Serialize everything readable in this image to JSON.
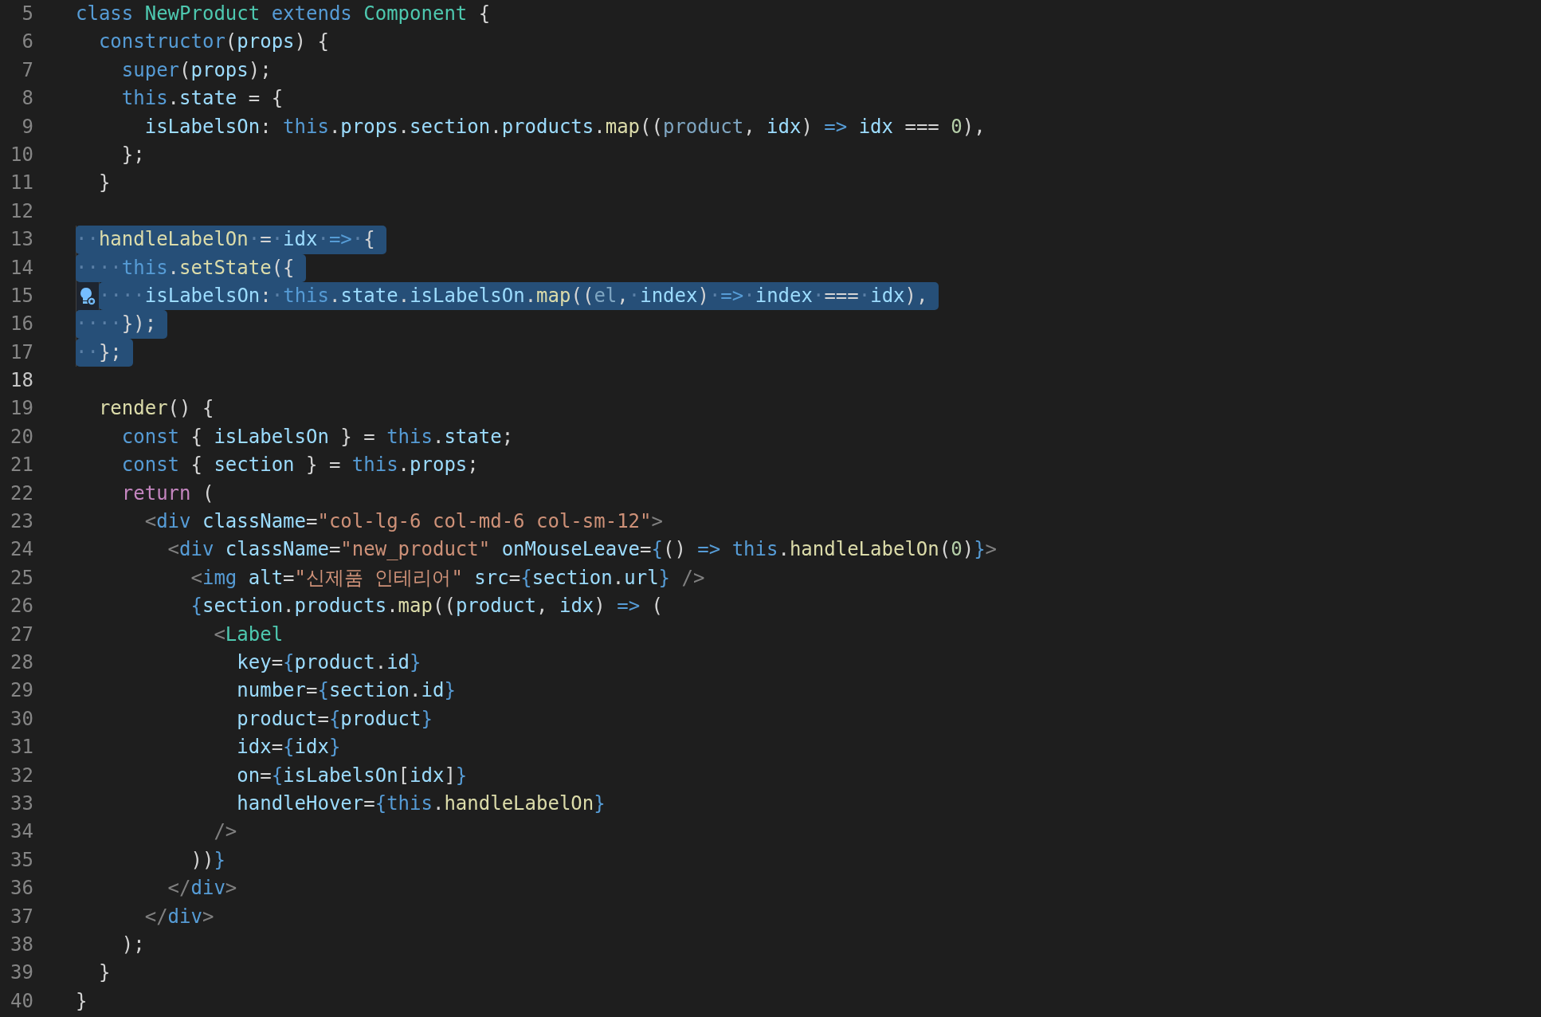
{
  "lines": [
    {
      "number": "5",
      "selected": false,
      "active": false,
      "lightbulb": false,
      "tokens": [
        {
          "kind": "kw",
          "text": "class "
        },
        {
          "kind": "type",
          "text": "NewProduct"
        },
        {
          "kind": "kw",
          "text": " extends "
        },
        {
          "kind": "type",
          "text": "Component"
        },
        {
          "kind": "pun",
          "text": " {"
        }
      ]
    },
    {
      "number": "6",
      "selected": false,
      "active": false,
      "lightbulb": false,
      "tokens": [
        {
          "kind": "kw",
          "text": "  constructor"
        },
        {
          "kind": "pun",
          "text": "("
        },
        {
          "kind": "var",
          "text": "props"
        },
        {
          "kind": "pun",
          "text": ") {"
        }
      ]
    },
    {
      "number": "7",
      "selected": false,
      "active": false,
      "lightbulb": false,
      "tokens": [
        {
          "kind": "kw",
          "text": "    super"
        },
        {
          "kind": "pun",
          "text": "("
        },
        {
          "kind": "var",
          "text": "props"
        },
        {
          "kind": "pun",
          "text": ");"
        }
      ]
    },
    {
      "number": "8",
      "selected": false,
      "active": false,
      "lightbulb": false,
      "tokens": [
        {
          "kind": "kw",
          "text": "    this"
        },
        {
          "kind": "pun",
          "text": "."
        },
        {
          "kind": "var",
          "text": "state"
        },
        {
          "kind": "pun",
          "text": " = {"
        }
      ]
    },
    {
      "number": "9",
      "selected": false,
      "active": false,
      "lightbulb": false,
      "tokens": [
        {
          "kind": "var",
          "text": "      isLabelsOn"
        },
        {
          "kind": "pun",
          "text": ": "
        },
        {
          "kind": "kw",
          "text": "this"
        },
        {
          "kind": "pun",
          "text": "."
        },
        {
          "kind": "var",
          "text": "props"
        },
        {
          "kind": "pun",
          "text": "."
        },
        {
          "kind": "var",
          "text": "section"
        },
        {
          "kind": "pun",
          "text": "."
        },
        {
          "kind": "var",
          "text": "products"
        },
        {
          "kind": "pun",
          "text": "."
        },
        {
          "kind": "fn",
          "text": "map"
        },
        {
          "kind": "pun",
          "text": "(("
        },
        {
          "kind": "unused",
          "text": "product"
        },
        {
          "kind": "pun",
          "text": ", "
        },
        {
          "kind": "var",
          "text": "idx"
        },
        {
          "kind": "pun",
          "text": ") "
        },
        {
          "kind": "kw",
          "text": "=>"
        },
        {
          "kind": "var",
          "text": " idx"
        },
        {
          "kind": "pun",
          "text": " === "
        },
        {
          "kind": "num",
          "text": "0"
        },
        {
          "kind": "pun",
          "text": "),"
        }
      ]
    },
    {
      "number": "10",
      "selected": false,
      "active": false,
      "lightbulb": false,
      "tokens": [
        {
          "kind": "pun",
          "text": "    };"
        }
      ]
    },
    {
      "number": "11",
      "selected": false,
      "active": false,
      "lightbulb": false,
      "tokens": [
        {
          "kind": "pun",
          "text": "  }"
        }
      ]
    },
    {
      "number": "12",
      "selected": false,
      "active": false,
      "lightbulb": false
    },
    {
      "number": "13",
      "selected": true,
      "active": false,
      "lightbulb": false,
      "tokens": [
        {
          "kind": "ws",
          "text": "··"
        },
        {
          "kind": "fn",
          "text": "handleLabelOn"
        },
        {
          "kind": "ws",
          "text": "·"
        },
        {
          "kind": "pun",
          "text": "="
        },
        {
          "kind": "ws",
          "text": "·"
        },
        {
          "kind": "var",
          "text": "idx"
        },
        {
          "kind": "ws",
          "text": "·"
        },
        {
          "kind": "kw",
          "text": "=>"
        },
        {
          "kind": "ws",
          "text": "·"
        },
        {
          "kind": "pun",
          "text": "{"
        }
      ]
    },
    {
      "number": "14",
      "selected": true,
      "active": false,
      "lightbulb": false,
      "tokens": [
        {
          "kind": "ws",
          "text": "····"
        },
        {
          "kind": "kw",
          "text": "this"
        },
        {
          "kind": "pun",
          "text": "."
        },
        {
          "kind": "fn",
          "text": "setState"
        },
        {
          "kind": "pun",
          "text": "({"
        }
      ]
    },
    {
      "number": "15",
      "selected": true,
      "active": false,
      "lightbulb": true,
      "tokens": [
        {
          "kind": "ws",
          "text": "····"
        },
        {
          "kind": "var",
          "text": "isLabelsOn"
        },
        {
          "kind": "pun",
          "text": ":"
        },
        {
          "kind": "ws",
          "text": "·"
        },
        {
          "kind": "kw",
          "text": "this"
        },
        {
          "kind": "pun",
          "text": "."
        },
        {
          "kind": "var",
          "text": "state"
        },
        {
          "kind": "pun",
          "text": "."
        },
        {
          "kind": "var",
          "text": "isLabelsOn"
        },
        {
          "kind": "pun",
          "text": "."
        },
        {
          "kind": "fn",
          "text": "map"
        },
        {
          "kind": "pun",
          "text": "(("
        },
        {
          "kind": "unused",
          "text": "el"
        },
        {
          "kind": "pun",
          "text": ","
        },
        {
          "kind": "ws",
          "text": "·"
        },
        {
          "kind": "var",
          "text": "index"
        },
        {
          "kind": "pun",
          "text": ")"
        },
        {
          "kind": "ws",
          "text": "·"
        },
        {
          "kind": "kw",
          "text": "=>"
        },
        {
          "kind": "ws",
          "text": "·"
        },
        {
          "kind": "var",
          "text": "index"
        },
        {
          "kind": "ws",
          "text": "·"
        },
        {
          "kind": "pun",
          "text": "==="
        },
        {
          "kind": "ws",
          "text": "·"
        },
        {
          "kind": "var",
          "text": "idx"
        },
        {
          "kind": "pun",
          "text": "),"
        }
      ]
    },
    {
      "number": "16",
      "selected": true,
      "active": false,
      "lightbulb": false,
      "tokens": [
        {
          "kind": "ws",
          "text": "····"
        },
        {
          "kind": "pun",
          "text": "});"
        }
      ]
    },
    {
      "number": "17",
      "selected": true,
      "active": false,
      "lightbulb": false,
      "tokens": [
        {
          "kind": "ws",
          "text": "··"
        },
        {
          "kind": "pun",
          "text": "};"
        }
      ]
    },
    {
      "number": "18",
      "selected": false,
      "active": true,
      "lightbulb": false
    },
    {
      "number": "19",
      "selected": false,
      "active": false,
      "lightbulb": false,
      "tokens": [
        {
          "kind": "fn",
          "text": "  render"
        },
        {
          "kind": "pun",
          "text": "() {"
        }
      ]
    },
    {
      "number": "20",
      "selected": false,
      "active": false,
      "lightbulb": false,
      "tokens": [
        {
          "kind": "kw",
          "text": "    const"
        },
        {
          "kind": "pun",
          "text": " { "
        },
        {
          "kind": "var",
          "text": "isLabelsOn"
        },
        {
          "kind": "pun",
          "text": " } = "
        },
        {
          "kind": "kw",
          "text": "this"
        },
        {
          "kind": "pun",
          "text": "."
        },
        {
          "kind": "var",
          "text": "state"
        },
        {
          "kind": "pun",
          "text": ";"
        }
      ]
    },
    {
      "number": "21",
      "selected": false,
      "active": false,
      "lightbulb": false,
      "tokens": [
        {
          "kind": "kw",
          "text": "    const"
        },
        {
          "kind": "pun",
          "text": " { "
        },
        {
          "kind": "var",
          "text": "section"
        },
        {
          "kind": "pun",
          "text": " } = "
        },
        {
          "kind": "kw",
          "text": "this"
        },
        {
          "kind": "pun",
          "text": "."
        },
        {
          "kind": "var",
          "text": "props"
        },
        {
          "kind": "pun",
          "text": ";"
        }
      ]
    },
    {
      "number": "22",
      "selected": false,
      "active": false,
      "lightbulb": false,
      "tokens": [
        {
          "kind": "ctl",
          "text": "    return"
        },
        {
          "kind": "pun",
          "text": " ("
        }
      ]
    },
    {
      "number": "23",
      "selected": false,
      "active": false,
      "lightbulb": false,
      "tokens": [
        {
          "kind": "tag",
          "text": "      <"
        },
        {
          "kind": "kw",
          "text": "div"
        },
        {
          "kind": "var",
          "text": " className"
        },
        {
          "kind": "pun",
          "text": "="
        },
        {
          "kind": "str",
          "text": "\"col-lg-6 col-md-6 col-sm-12\""
        },
        {
          "kind": "tag",
          "text": ">"
        }
      ]
    },
    {
      "number": "24",
      "selected": false,
      "active": false,
      "lightbulb": false,
      "tokens": [
        {
          "kind": "tag",
          "text": "        <"
        },
        {
          "kind": "kw",
          "text": "div"
        },
        {
          "kind": "var",
          "text": " className"
        },
        {
          "kind": "pun",
          "text": "="
        },
        {
          "kind": "str",
          "text": "\"new_product\""
        },
        {
          "kind": "var",
          "text": " onMouseLeave"
        },
        {
          "kind": "pun",
          "text": "="
        },
        {
          "kind": "kw",
          "text": "{"
        },
        {
          "kind": "pun",
          "text": "() "
        },
        {
          "kind": "kw",
          "text": "=>"
        },
        {
          "kind": "kw",
          "text": " this"
        },
        {
          "kind": "pun",
          "text": "."
        },
        {
          "kind": "fn",
          "text": "handleLabelOn"
        },
        {
          "kind": "pun",
          "text": "("
        },
        {
          "kind": "num",
          "text": "0"
        },
        {
          "kind": "pun",
          "text": ")"
        },
        {
          "kind": "kw",
          "text": "}"
        },
        {
          "kind": "tag",
          "text": ">"
        }
      ]
    },
    {
      "number": "25",
      "selected": false,
      "active": false,
      "lightbulb": false,
      "tokens": [
        {
          "kind": "tag",
          "text": "          <"
        },
        {
          "kind": "kw",
          "text": "img"
        },
        {
          "kind": "var",
          "text": " alt"
        },
        {
          "kind": "pun",
          "text": "="
        },
        {
          "kind": "str",
          "text": "\"신제품 인테리어\""
        },
        {
          "kind": "var",
          "text": " src"
        },
        {
          "kind": "pun",
          "text": "="
        },
        {
          "kind": "kw",
          "text": "{"
        },
        {
          "kind": "var",
          "text": "section"
        },
        {
          "kind": "pun",
          "text": "."
        },
        {
          "kind": "var",
          "text": "url"
        },
        {
          "kind": "kw",
          "text": "}"
        },
        {
          "kind": "tag",
          "text": " />"
        }
      ]
    },
    {
      "number": "26",
      "selected": false,
      "active": false,
      "lightbulb": false,
      "tokens": [
        {
          "kind": "kw",
          "text": "          {"
        },
        {
          "kind": "var",
          "text": "section"
        },
        {
          "kind": "pun",
          "text": "."
        },
        {
          "kind": "var",
          "text": "products"
        },
        {
          "kind": "pun",
          "text": "."
        },
        {
          "kind": "fn",
          "text": "map"
        },
        {
          "kind": "pun",
          "text": "(("
        },
        {
          "kind": "var",
          "text": "product"
        },
        {
          "kind": "pun",
          "text": ", "
        },
        {
          "kind": "var",
          "text": "idx"
        },
        {
          "kind": "pun",
          "text": ") "
        },
        {
          "kind": "kw",
          "text": "=>"
        },
        {
          "kind": "pun",
          "text": " ("
        }
      ]
    },
    {
      "number": "27",
      "selected": false,
      "active": false,
      "lightbulb": false,
      "tokens": [
        {
          "kind": "tag",
          "text": "            <"
        },
        {
          "kind": "type",
          "text": "Label"
        }
      ]
    },
    {
      "number": "28",
      "selected": false,
      "active": false,
      "lightbulb": false,
      "tokens": [
        {
          "kind": "var",
          "text": "              key"
        },
        {
          "kind": "pun",
          "text": "="
        },
        {
          "kind": "kw",
          "text": "{"
        },
        {
          "kind": "var",
          "text": "product"
        },
        {
          "kind": "pun",
          "text": "."
        },
        {
          "kind": "var",
          "text": "id"
        },
        {
          "kind": "kw",
          "text": "}"
        }
      ]
    },
    {
      "number": "29",
      "selected": false,
      "active": false,
      "lightbulb": false,
      "tokens": [
        {
          "kind": "var",
          "text": "              number"
        },
        {
          "kind": "pun",
          "text": "="
        },
        {
          "kind": "kw",
          "text": "{"
        },
        {
          "kind": "var",
          "text": "section"
        },
        {
          "kind": "pun",
          "text": "."
        },
        {
          "kind": "var",
          "text": "id"
        },
        {
          "kind": "kw",
          "text": "}"
        }
      ]
    },
    {
      "number": "30",
      "selected": false,
      "active": false,
      "lightbulb": false,
      "tokens": [
        {
          "kind": "var",
          "text": "              product"
        },
        {
          "kind": "pun",
          "text": "="
        },
        {
          "kind": "kw",
          "text": "{"
        },
        {
          "kind": "var",
          "text": "product"
        },
        {
          "kind": "kw",
          "text": "}"
        }
      ]
    },
    {
      "number": "31",
      "selected": false,
      "active": false,
      "lightbulb": false,
      "tokens": [
        {
          "kind": "var",
          "text": "              idx"
        },
        {
          "kind": "pun",
          "text": "="
        },
        {
          "kind": "kw",
          "text": "{"
        },
        {
          "kind": "var",
          "text": "idx"
        },
        {
          "kind": "kw",
          "text": "}"
        }
      ]
    },
    {
      "number": "32",
      "selected": false,
      "active": false,
      "lightbulb": false,
      "tokens": [
        {
          "kind": "var",
          "text": "              on"
        },
        {
          "kind": "pun",
          "text": "="
        },
        {
          "kind": "kw",
          "text": "{"
        },
        {
          "kind": "var",
          "text": "isLabelsOn"
        },
        {
          "kind": "pun",
          "text": "["
        },
        {
          "kind": "var",
          "text": "idx"
        },
        {
          "kind": "pun",
          "text": "]"
        },
        {
          "kind": "kw",
          "text": "}"
        }
      ]
    },
    {
      "number": "33",
      "selected": false,
      "active": false,
      "lightbulb": false,
      "tokens": [
        {
          "kind": "var",
          "text": "              handleHover"
        },
        {
          "kind": "pun",
          "text": "="
        },
        {
          "kind": "kw",
          "text": "{this"
        },
        {
          "kind": "pun",
          "text": "."
        },
        {
          "kind": "fn",
          "text": "handleLabelOn"
        },
        {
          "kind": "kw",
          "text": "}"
        }
      ]
    },
    {
      "number": "34",
      "selected": false,
      "active": false,
      "lightbulb": false,
      "tokens": [
        {
          "kind": "tag",
          "text": "            />"
        }
      ]
    },
    {
      "number": "35",
      "selected": false,
      "active": false,
      "lightbulb": false,
      "tokens": [
        {
          "kind": "pun",
          "text": "          ))"
        },
        {
          "kind": "kw",
          "text": "}"
        }
      ]
    },
    {
      "number": "36",
      "selected": false,
      "active": false,
      "lightbulb": false,
      "tokens": [
        {
          "kind": "tag",
          "text": "        </"
        },
        {
          "kind": "kw",
          "text": "div"
        },
        {
          "kind": "tag",
          "text": ">"
        }
      ]
    },
    {
      "number": "37",
      "selected": false,
      "active": false,
      "lightbulb": false,
      "tokens": [
        {
          "kind": "tag",
          "text": "      </"
        },
        {
          "kind": "kw",
          "text": "div"
        },
        {
          "kind": "tag",
          "text": ">"
        }
      ]
    },
    {
      "number": "38",
      "selected": false,
      "active": false,
      "lightbulb": false,
      "tokens": [
        {
          "kind": "pun",
          "text": "    );"
        }
      ]
    },
    {
      "number": "39",
      "selected": false,
      "active": false,
      "lightbulb": false,
      "tokens": [
        {
          "kind": "pun",
          "text": "  }"
        }
      ]
    },
    {
      "number": "40",
      "selected": false,
      "active": false,
      "lightbulb": false,
      "tokens": [
        {
          "kind": "pun",
          "text": "}"
        }
      ]
    }
  ]
}
